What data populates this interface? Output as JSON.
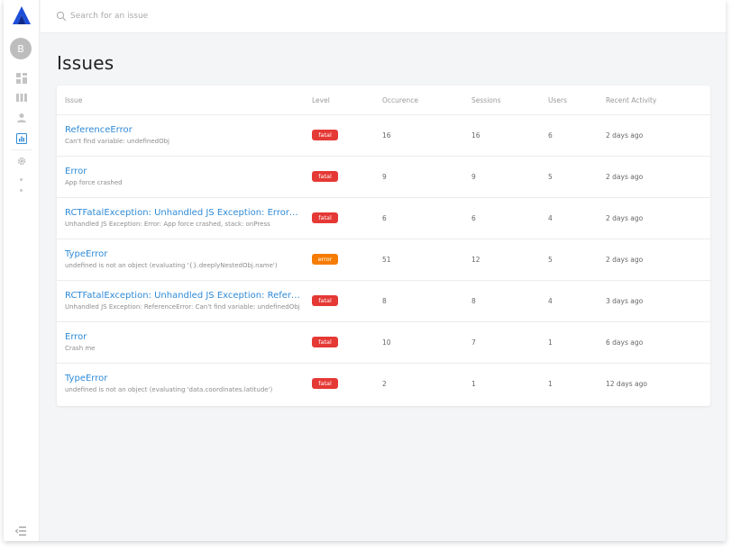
{
  "search": {
    "placeholder": "Search for an issue"
  },
  "user": {
    "initial": "B"
  },
  "page": {
    "title": "Issues"
  },
  "colors": {
    "accent": "#2f8bd8",
    "fatal": "#e53935",
    "error": "#f57c00",
    "logo": "#1e4fd8"
  },
  "sidebar": {
    "icons": [
      "dashboard-icon",
      "board-icon",
      "user-icon",
      "chart-icon",
      "settings-icon"
    ],
    "active": "chart-icon"
  },
  "table": {
    "headers": {
      "issue": "Issue",
      "level": "Level",
      "occurence": "Occurence",
      "sessions": "Sessions",
      "users": "Users",
      "recent": "Recent Activity"
    },
    "rows": [
      {
        "title": "ReferenceError",
        "subtitle": "Can't find variable: undefinedObj",
        "level": "fatal",
        "occurence": "16",
        "sessions": "16",
        "users": "6",
        "recent": "2 days ago"
      },
      {
        "title": "Error",
        "subtitle": "App force crashed",
        "level": "fatal",
        "occurence": "9",
        "sessions": "9",
        "users": "5",
        "recent": "2 days ago"
      },
      {
        "title": "RCTFatalException: Unhandled JS Exception: Error: App force crashed",
        "subtitle": "Unhandled JS Exception: Error: App force crashed, stack: onPress",
        "level": "fatal",
        "occurence": "6",
        "sessions": "6",
        "users": "4",
        "recent": "2 days ago"
      },
      {
        "title": "TypeError",
        "subtitle": "undefined is not an object (evaluating '{}.deeplyNestedObj.name')",
        "level": "error",
        "occurence": "51",
        "sessions": "12",
        "users": "5",
        "recent": "2 days ago"
      },
      {
        "title": "RCTFatalException: Unhandled JS Exception: ReferenceError",
        "subtitle": "Unhandled JS Exception: ReferenceError: Can't find variable: undefinedObj",
        "level": "fatal",
        "occurence": "8",
        "sessions": "8",
        "users": "4",
        "recent": "3 days ago"
      },
      {
        "title": "Error",
        "subtitle": "Crash me",
        "level": "fatal",
        "occurence": "10",
        "sessions": "7",
        "users": "1",
        "recent": "6 days ago"
      },
      {
        "title": "TypeError",
        "subtitle": "undefined is not an object (evaluating 'data.coordinates.latitude')",
        "level": "fatal",
        "occurence": "2",
        "sessions": "1",
        "users": "1",
        "recent": "12 days ago"
      }
    ]
  }
}
